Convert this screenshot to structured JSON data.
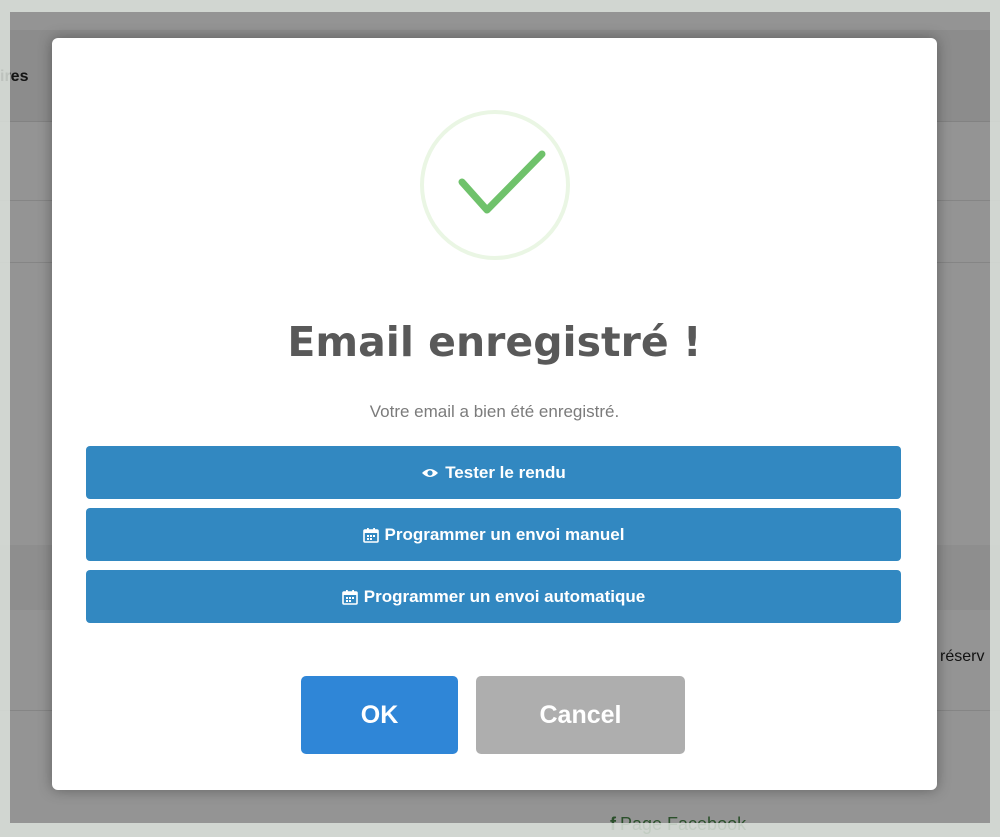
{
  "background": {
    "header_text": "ires",
    "side_text": "réserv",
    "bottom_link": "Page Facebook",
    "bottom_icon": "facebook-icon"
  },
  "modal": {
    "icon": "checkmark-icon",
    "icon_color": "#6fc26b",
    "title": "Email enregistré !",
    "text": "Votre email a bien été enregistré.",
    "actions": [
      {
        "icon": "eye-icon",
        "label": "Tester le rendu"
      },
      {
        "icon": "calendar-icon",
        "label": "Programmer un envoi manuel"
      },
      {
        "icon": "calendar-icon",
        "label": "Programmer un envoi automatique"
      }
    ],
    "action_color": "#3288c1",
    "ok_label": "OK",
    "ok_color": "#2f86d7",
    "cancel_label": "Cancel",
    "cancel_color": "#aeaeae"
  }
}
